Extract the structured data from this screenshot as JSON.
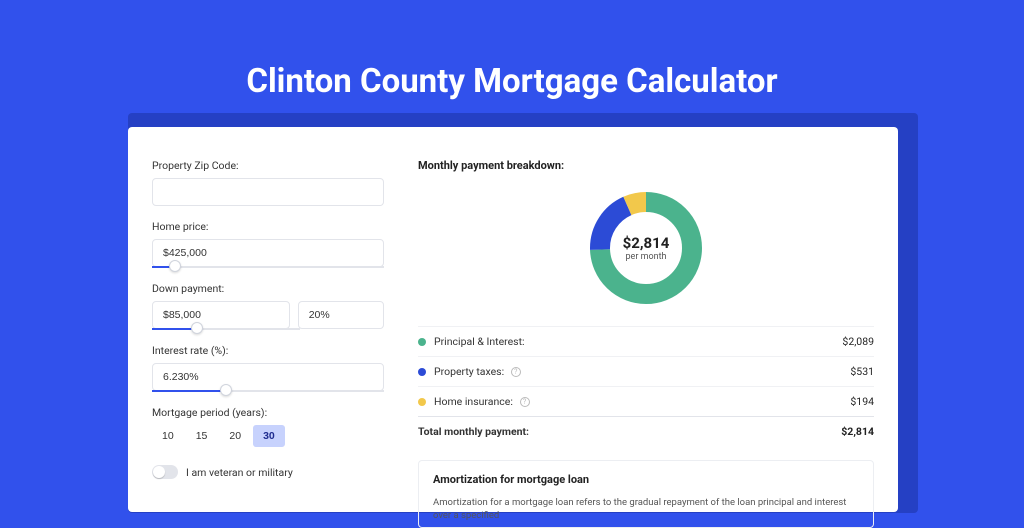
{
  "title": "Clinton County Mortgage Calculator",
  "form": {
    "zip_label": "Property Zip Code:",
    "zip_value": "",
    "home_price_label": "Home price:",
    "home_price_value": "$425,000",
    "down_payment_label": "Down payment:",
    "down_payment_value": "$85,000",
    "down_payment_pct": "20%",
    "interest_label": "Interest rate (%):",
    "interest_value": "6.230%",
    "period_label": "Mortgage period (years):",
    "periods": [
      "10",
      "15",
      "20",
      "30"
    ],
    "period_active": "30",
    "veteran_label": "I am veteran or military"
  },
  "breakdown": {
    "title": "Monthly payment breakdown:",
    "center_amount": "$2,814",
    "center_sub": "per month",
    "rows": [
      {
        "label": "Principal & Interest:",
        "value": "$2,089",
        "color": "#4bb38d"
      },
      {
        "label": "Property taxes:",
        "value": "$531",
        "color": "#2c4bd6",
        "info": true
      },
      {
        "label": "Home insurance:",
        "value": "$194",
        "color": "#f2c84b",
        "info": true
      }
    ],
    "total_label": "Total monthly payment:",
    "total_value": "$2,814"
  },
  "amort": {
    "title": "Amortization for mortgage loan",
    "body": "Amortization for a mortgage loan refers to the gradual repayment of the loan principal and interest over a specified"
  },
  "chart_data": {
    "type": "pie",
    "title": "Monthly payment breakdown",
    "series": [
      {
        "name": "Principal & Interest",
        "value": 2089,
        "color": "#4bb38d"
      },
      {
        "name": "Property taxes",
        "value": 531,
        "color": "#2c4bd6"
      },
      {
        "name": "Home insurance",
        "value": 194,
        "color": "#f2c84b"
      }
    ],
    "total": 2814,
    "unit": "USD per month"
  }
}
